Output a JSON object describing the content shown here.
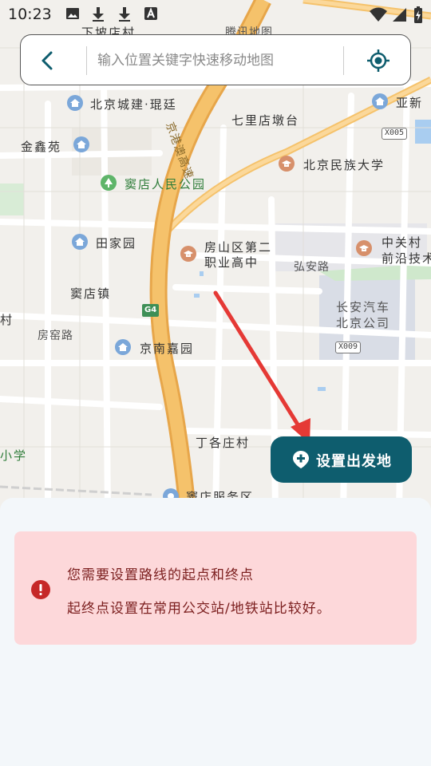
{
  "status_bar": {
    "time": "10:23",
    "icons": [
      "image-icon",
      "download-icon",
      "download-icon",
      "font-icon",
      "wifi-icon",
      "signal-icon",
      "battery-charging-icon"
    ]
  },
  "search": {
    "placeholder": "输入位置关键字快速移动地图",
    "value": "",
    "back_icon": "chevron-left-icon",
    "locate_icon": "crosshair-icon"
  },
  "map": {
    "labels": {
      "top_village": "下坡店村",
      "tencent": "腾讯地图",
      "bj_chengjian": "北京城建·琨廷",
      "qilidian": "七里店墩台",
      "yaxin": "亚新",
      "jinxinyuan": "金鑫苑",
      "bj_minzu": "北京民族大学",
      "doudian_park": "窦店人民公园",
      "tianjiayuan": "田家园",
      "fangshan_1": "房山区第二",
      "fangshan_2": "职业高中",
      "zgc_1": "中关村",
      "zgc_2": "前沿技术",
      "hongan": "弘安路",
      "doudianzhen": "窦店镇",
      "changan_1": "长安汽车",
      "changan_2": "北京公司",
      "cun": "村",
      "fangyao": "房窑路",
      "jingnan": "京南嘉园",
      "dinggezhuang": "丁各庄村",
      "xiaoxue": "小学",
      "service_area": "窦店服务区",
      "highway_1": "京港澳高速"
    },
    "shields": {
      "x005": "X005",
      "x009": "X009",
      "g4": "G4"
    }
  },
  "actions": {
    "set_start_label": "设置出发地",
    "set_start_icon": "pin-plus-icon"
  },
  "alert": {
    "icon": "error-icon",
    "line1": "您需要设置路线的起点和终点",
    "line2": "起终点设置在常用公交站/地铁站比较好。",
    "accent": "#c62828",
    "background": "#fdd8da"
  },
  "colors": {
    "primary": "#0e5d6e",
    "highway": "#f5c26b",
    "arrow": "#e53935"
  }
}
